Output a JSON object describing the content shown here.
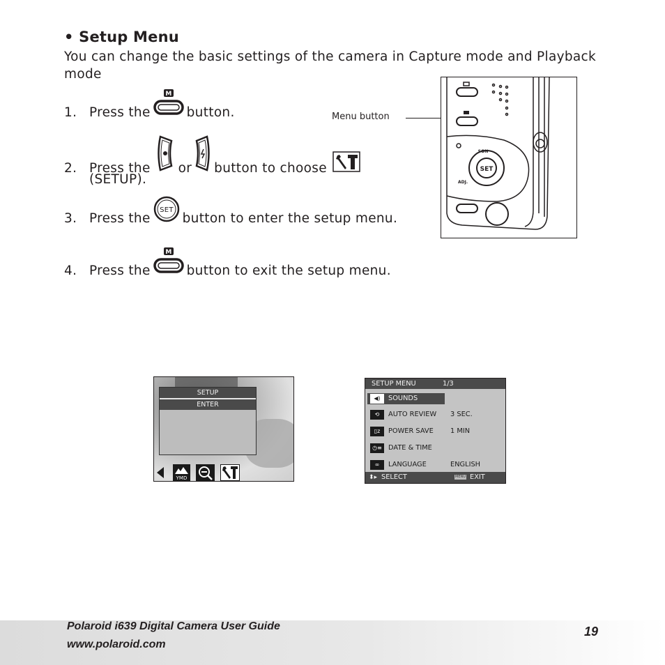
{
  "section": {
    "title": "• Setup Menu",
    "intro": "You can change the basic settings of the camera in Capture mode and Playback mode"
  },
  "steps": [
    {
      "number": "1.",
      "before": "Press the",
      "icon": "menu-button-icon",
      "icon_badge": "M",
      "after": "button."
    },
    {
      "number": "2.",
      "before": "Press the",
      "icon_a": "left-arrow-button-icon",
      "mid": "or",
      "icon_b": "right-arrow-button-icon",
      "after": "button to choose",
      "icon_c": "setup-tools-icon",
      "continuation": "(SETUP)."
    },
    {
      "number": "3.",
      "before": "Press the",
      "icon": "set-button-icon",
      "icon_badge": "SET",
      "after": "button to enter the setup menu."
    },
    {
      "number": "4.",
      "before": "Press the",
      "icon": "menu-button-icon",
      "icon_badge": "M",
      "after": "button to exit the setup menu."
    }
  ],
  "camera_figure": {
    "callout_label": "Menu button",
    "labels": {
      "set": "SET",
      "top": "SON",
      "left_bottom": "ADJ."
    }
  },
  "lcd_capture": {
    "menu_title": "SETUP",
    "menu_item": "ENTER",
    "bottom_icons": [
      "left-arrow-icon",
      "date-stamp-icon",
      "zoom-out-icon",
      "setup-tools-icon"
    ],
    "date_stamp_label": "YMD"
  },
  "lcd_setup_menu": {
    "header": "SETUP MENU",
    "page": "1/3",
    "rows": [
      {
        "icon": "speaker-icon",
        "label": "SOUNDS",
        "value": "",
        "selected": true
      },
      {
        "icon": "auto-review-icon",
        "label": "AUTO REVIEW",
        "value": "3 SEC.",
        "selected": false
      },
      {
        "icon": "power-save-icon",
        "label": "POWER SAVE",
        "value": "1 MIN",
        "selected": false
      },
      {
        "icon": "date-time-icon",
        "label": "DATE & TIME",
        "value": "",
        "selected": false
      },
      {
        "icon": "language-icon",
        "label": "LANGUAGE",
        "value": "ENGLISH",
        "selected": false
      }
    ],
    "footer_select": "SELECT",
    "footer_menu_badge": "MENU",
    "footer_exit": "EXIT"
  },
  "footer": {
    "guide_title": "Polaroid i639 Digital Camera User Guide",
    "url": "www.polaroid.com",
    "page_number": "19"
  }
}
